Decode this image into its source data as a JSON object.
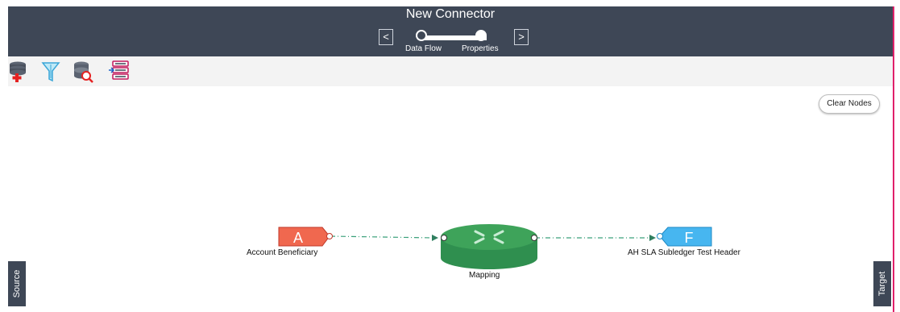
{
  "header": {
    "title": "New Connector",
    "prev_label": "<",
    "next_label": ">",
    "steps": [
      {
        "label": "Data Flow",
        "active": false
      },
      {
        "label": "Properties",
        "active": true
      }
    ]
  },
  "toolbar": {
    "tools": [
      {
        "icon": "add-database-icon"
      },
      {
        "icon": "filter-icon"
      },
      {
        "icon": "database-search-icon"
      },
      {
        "icon": "list-import-icon"
      }
    ]
  },
  "canvas": {
    "clear_nodes_label": "Clear Nodes",
    "source_node": {
      "letter": "A",
      "label": "Account Beneficiary",
      "color": "#f0684f"
    },
    "mapping_node": {
      "label": "Mapping",
      "color": "#3ea35a"
    },
    "target_node": {
      "letter": "F",
      "label": "AH SLA Subledger Test Header",
      "color": "#47b6f0"
    },
    "source_tab": "Source",
    "target_tab": "Target"
  },
  "colors": {
    "header_bg": "#3e4756",
    "toolbar_bg": "#f3f3f3",
    "connector_line": "#3aa07a",
    "border_accent": "#e0206a"
  }
}
